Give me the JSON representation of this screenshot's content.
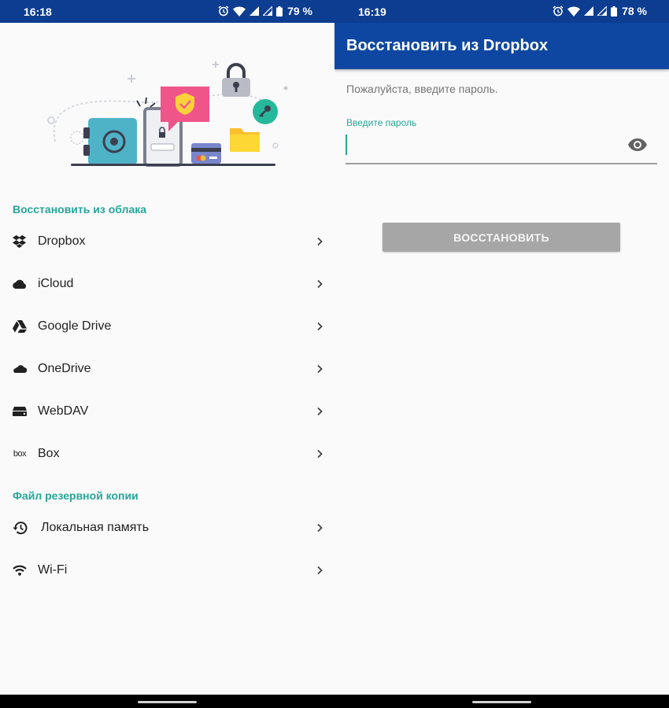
{
  "colors": {
    "status_bar": "#0d3d91",
    "app_bar": "#0d47a1",
    "accent": "#26a69a",
    "background": "#fafafa",
    "disabled_button": "#a6a6a6"
  },
  "left": {
    "status": {
      "time": "16:18",
      "battery": "79 %"
    },
    "sections": [
      {
        "header": "Восстановить из облака",
        "items": [
          {
            "label": "Dropbox",
            "icon": "dropbox-icon"
          },
          {
            "label": "iCloud",
            "icon": "cloud-icon"
          },
          {
            "label": "Google Drive",
            "icon": "google-drive-icon"
          },
          {
            "label": "OneDrive",
            "icon": "onedrive-icon"
          },
          {
            "label": "WebDAV",
            "icon": "server-icon"
          },
          {
            "label": "Box",
            "icon": "box-logo-icon",
            "icon_text": "box"
          }
        ]
      },
      {
        "header": "Файл резервной копии",
        "items": [
          {
            "label": "Локальная память",
            "icon": "history-icon"
          },
          {
            "label": "Wi-Fi",
            "icon": "wifi-icon"
          }
        ]
      }
    ]
  },
  "right": {
    "status": {
      "time": "16:19",
      "battery": "78 %"
    },
    "app_bar_title": "Восстановить из Dropbox",
    "prompt": "Пожалуйста, введите пароль.",
    "password_label": "Введите пароль",
    "password_value": "",
    "restore_button": "ВОССТАНОВИТЬ"
  }
}
